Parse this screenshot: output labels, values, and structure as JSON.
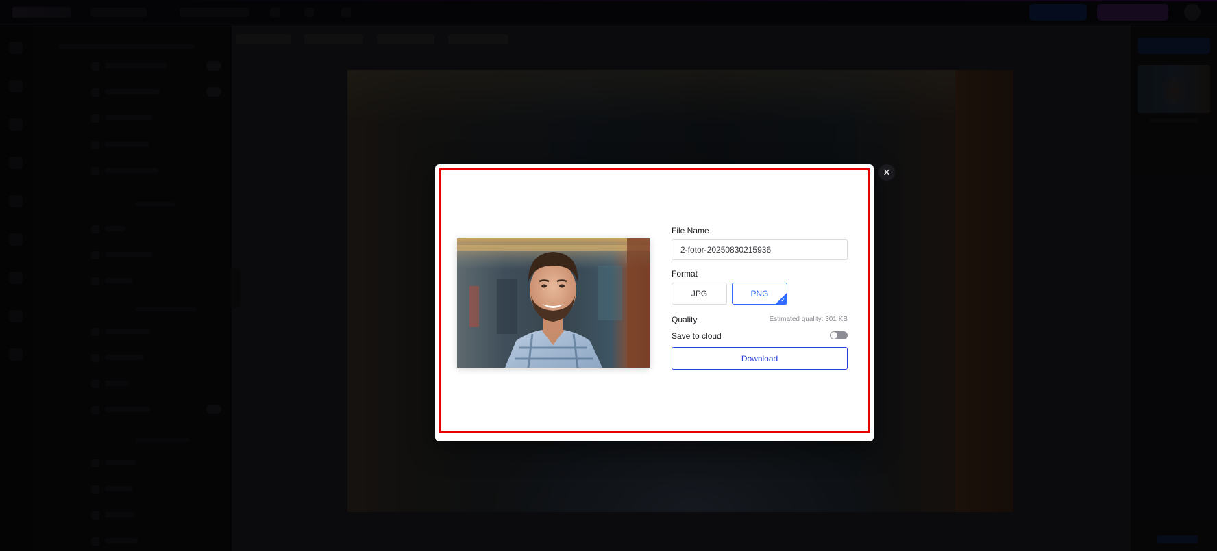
{
  "dialog": {
    "close_symbol": "×",
    "file_name_label": "File Name",
    "file_name_value": "2-fotor-20250830215936",
    "format_label": "Format",
    "formats": [
      {
        "label": "JPG",
        "selected": false
      },
      {
        "label": "PNG",
        "selected": true
      }
    ],
    "quality_label": "Quality",
    "estimated_quality": "Estimated quality: 301 KB",
    "save_to_cloud_label": "Save to cloud",
    "save_to_cloud_enabled": false,
    "download_label": "Download",
    "check_symbol": "✓"
  },
  "colors": {
    "accent_blue": "#2f6bff",
    "download_blue": "#2a3fd6",
    "highlight_red": "#e60000"
  },
  "icons": [
    "close-icon",
    "checkmark-icon",
    "toggle-switch"
  ]
}
